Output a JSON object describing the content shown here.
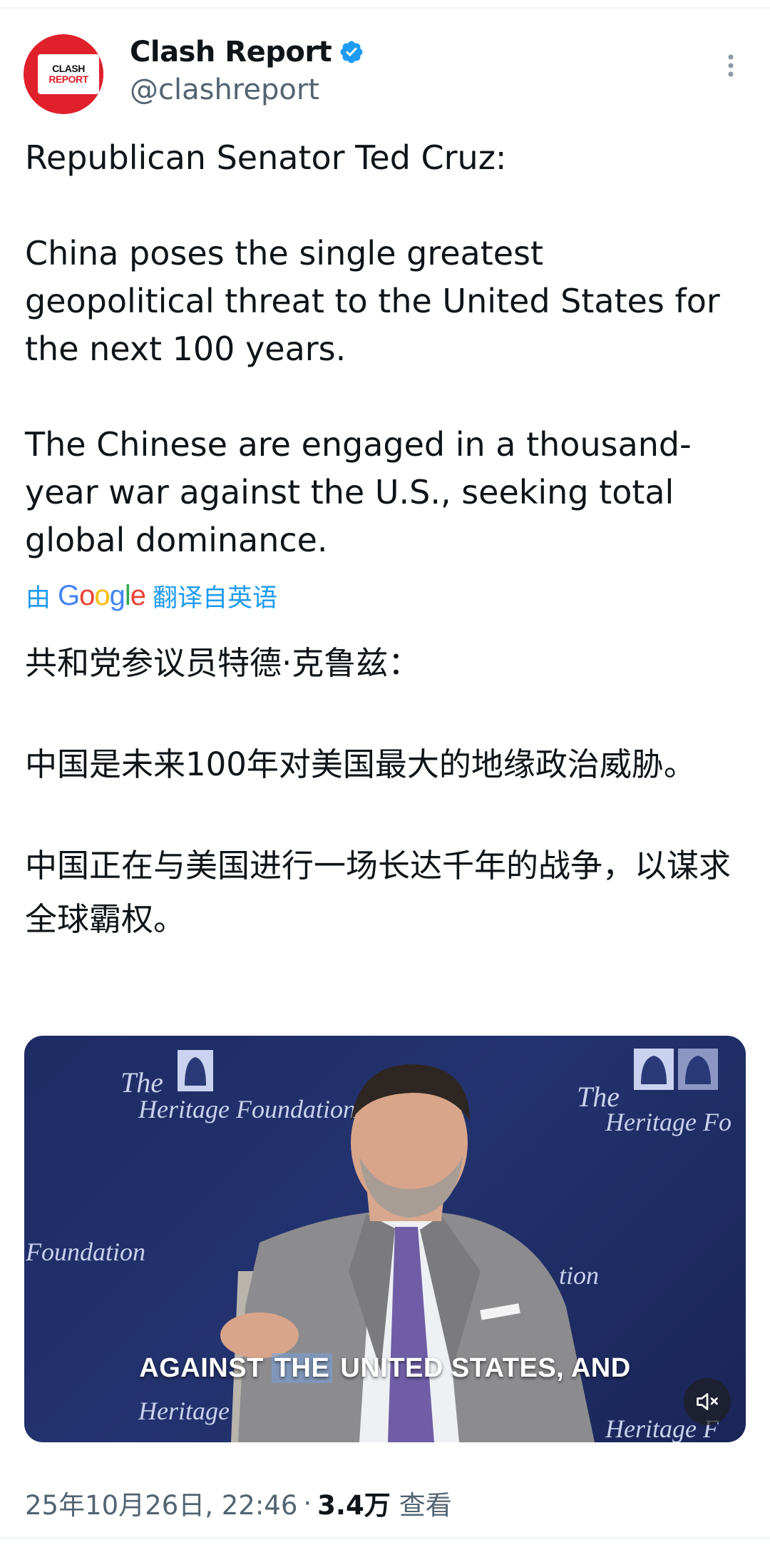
{
  "author": {
    "name": "Clash Report",
    "handle": "@clashreport",
    "avatar_line1": "CLASH",
    "avatar_line2": "REPORT",
    "verified": true
  },
  "post": {
    "en_lines": [
      "Republican Senator Ted Cruz:",
      "China poses the single greatest geopolitical threat to the United States for the next 100 years.",
      "The Chinese are engaged in a thousand-year war against the U.S., seeking total global dominance."
    ],
    "translation": {
      "by": "由",
      "engine": "Google",
      "from": "翻译自英语"
    },
    "zh_lines": [
      "共和党参议员特德·克鲁兹：",
      "中国是未来100年对美国最大的地缘政治威胁。",
      "中国正在与美国进行一场长达千年的战争，以谋求全球霸权。"
    ]
  },
  "video": {
    "logo_the": "The",
    "logo_name": "Heritage Foundation",
    "logo_partial_right": "Heritage Fo",
    "logo_partial_left": "Foundation",
    "logo_partial_mid": "tion",
    "logo_partial_bottom": "Heritage",
    "logo_partial_bottom_right": "Heritage F",
    "subtitle_before": "AGAINST ",
    "subtitle_hl1": "THE",
    "subtitle_mid": " UNITED",
    "subtitle_after": " STATES, AND",
    "mute_icon": "speaker-muted-icon"
  },
  "meta": {
    "timestamp": "25年10月26日, 22:46",
    "separator": "·",
    "views": "3.4万",
    "views_label": "查看"
  },
  "colors": {
    "accent": "#1d9bf0",
    "brand_red": "#e0202b",
    "video_bg": "#1e2b63"
  }
}
